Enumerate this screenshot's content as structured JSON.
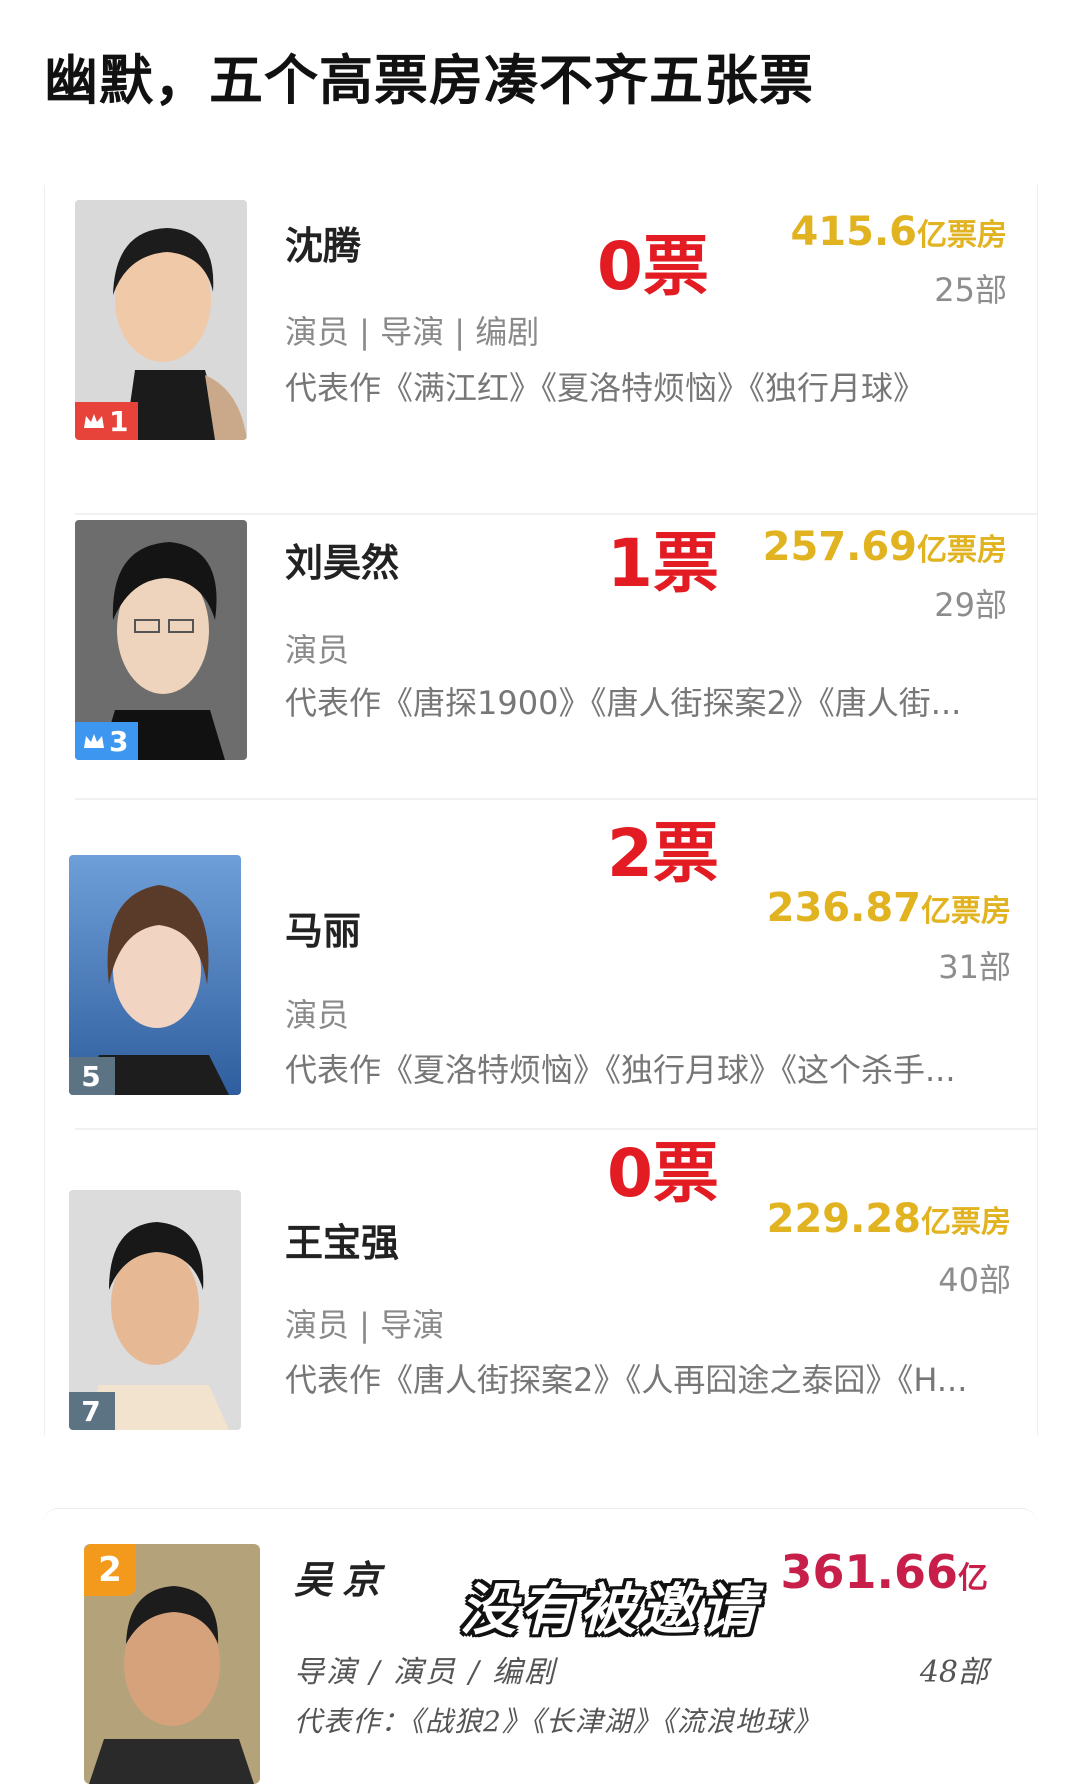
{
  "headline": "幽默，五个高票房凑不齐五张票",
  "colors": {
    "votes_red": "#e31c24",
    "box_gold": "#e2b320",
    "rank_red": "#e8433b",
    "rank_blue": "#3d97f0",
    "rank_gray": "#5c7384",
    "wujing_box": "#c81e4a"
  },
  "cards": [
    {
      "rank": "1",
      "rank_style": "red",
      "crown": true,
      "name": "沈腾",
      "votes": "0票",
      "box_value": "415.6",
      "box_unit": "亿票房",
      "count": "25部",
      "roles": "演员 | 导演 | 编剧",
      "works": "代表作《满江红》《夏洛特烦恼》《独行月球》"
    },
    {
      "rank": "3",
      "rank_style": "blue",
      "crown": true,
      "name": "刘昊然",
      "votes": "1票",
      "box_value": "257.69",
      "box_unit": "亿票房",
      "count": "29部",
      "roles": "演员",
      "works": "代表作《唐探1900》《唐人街探案2》《唐人街..."
    },
    {
      "rank": "5",
      "rank_style": "gray",
      "crown": false,
      "name": "马丽",
      "votes": "2票",
      "box_value": "236.87",
      "box_unit": "亿票房",
      "count": "31部",
      "roles": "演员",
      "works": "代表作《夏洛特烦恼》《独行月球》《这个杀手..."
    },
    {
      "rank": "7",
      "rank_style": "gray",
      "crown": false,
      "name": "王宝强",
      "votes": "0票",
      "box_value": "229.28",
      "box_unit": "亿票房",
      "count": "40部",
      "roles": "演员 | 导演",
      "works": "代表作《唐人街探案2》《人再囧途之泰囧》《H..."
    }
  ],
  "wujing": {
    "rank": "2",
    "name": "吴京",
    "box_value": "361.66",
    "box_unit": "亿",
    "count": "48部",
    "roles": "导演 / 演员 / 编剧",
    "works": "代表作：《战狼2》《长津湖》《流浪地球》"
  },
  "stamp": "没有被邀请"
}
